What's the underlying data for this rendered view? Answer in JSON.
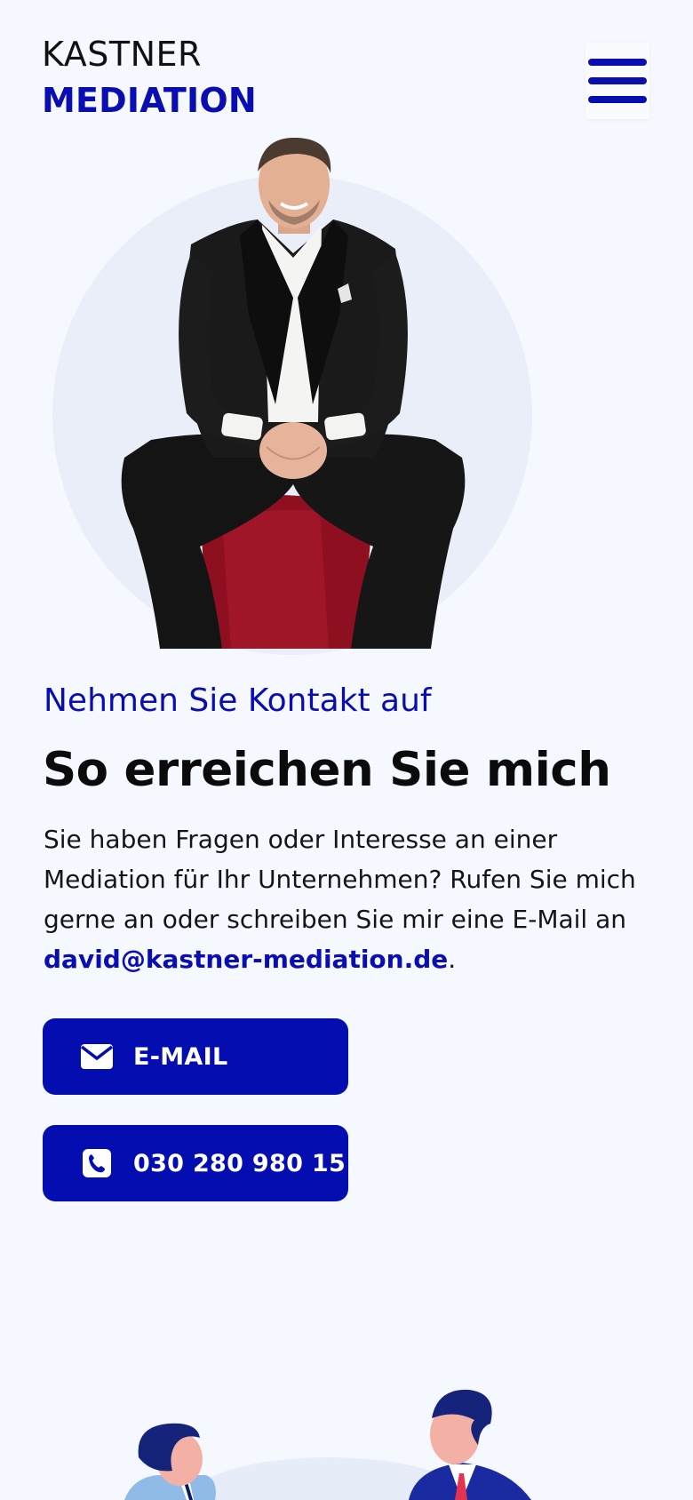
{
  "header": {
    "logo_line1": "KASTNER",
    "logo_line2": "MEDIATION",
    "menu_icon": "hamburger-menu-icon"
  },
  "contact": {
    "eyebrow": "Nehmen Sie Kontakt auf",
    "title": "So erreichen Sie mich",
    "body_before": "Sie haben Fragen oder Interesse an einer Mediation für Ihr Unternehmen? Rufen Sie mich gerne an oder schreiben Sie mir eine E-Mail an ",
    "email": "david@kastner-mediation.de",
    "body_after": "."
  },
  "buttons": {
    "email_label": "E-MAIL",
    "email_icon": "envelope-icon",
    "phone_label": "030 280 980 15",
    "phone_icon": "phone-icon"
  },
  "colors": {
    "brand_blue": "#0a0eb0",
    "background": "#f5f8fe",
    "button_blue": "#030db0"
  }
}
